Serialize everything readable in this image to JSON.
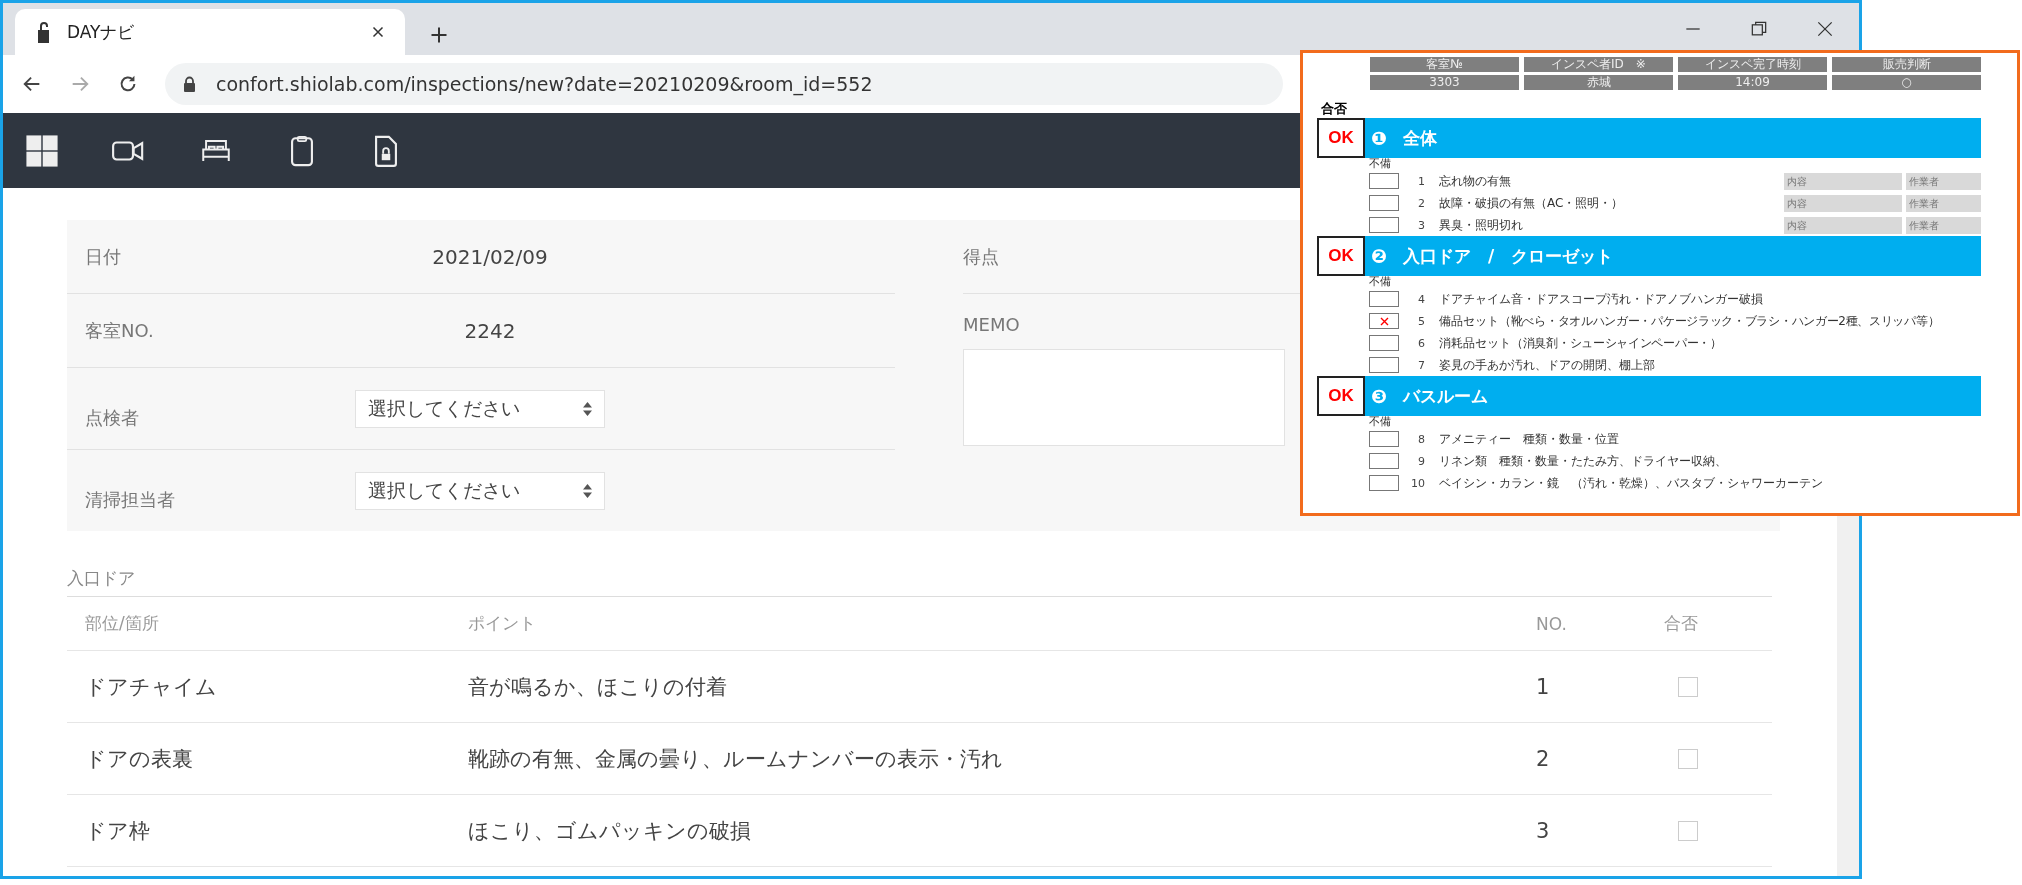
{
  "browser": {
    "tab_title": "DAYナビ",
    "url": "confort.shiolab.com/inspections/new?date=20210209&room_id=552"
  },
  "info": {
    "fields": [
      {
        "label": "日付",
        "kind": "text",
        "value": "2021/02/09"
      },
      {
        "label": "客室NO.",
        "kind": "text",
        "value": "2242"
      },
      {
        "label": "点検者",
        "kind": "select",
        "value": "選択してください"
      },
      {
        "label": "清掃担当者",
        "kind": "select",
        "value": "選択してください"
      }
    ],
    "score_label": "得点",
    "memo_label": "MEMO"
  },
  "checklist": {
    "title": "入口ドア",
    "columns": [
      "部位/箇所",
      "ポイント",
      "NO.",
      "合否"
    ],
    "rows": [
      {
        "part": "ドアチャイム",
        "point": "音が鳴るか、ほこりの付着",
        "no": "1",
        "checked": false
      },
      {
        "part": "ドアの表裏",
        "point": "靴跡の有無、金属の曇り、ルームナンバーの表示・汚れ",
        "no": "2",
        "checked": false
      },
      {
        "part": "ドア枠",
        "point": "ほこり、ゴムパッキンの破損",
        "no": "3",
        "checked": false
      }
    ]
  },
  "scan": {
    "header_labels": [
      "客室№",
      "インスペ者ID　※",
      "インスペ完了時刻",
      "販売判断"
    ],
    "header_values": [
      "3303",
      "赤城",
      "14:09",
      "○"
    ],
    "pass_label": "合否",
    "sections": [
      {
        "badge": "OK",
        "number": "❶",
        "title": "全体",
        "defect_label": "不備",
        "items": [
          {
            "no": "1",
            "text": "忘れ物の有無",
            "checked": false,
            "note": "内容",
            "worker": "作業者"
          },
          {
            "no": "2",
            "text": "故障・破損の有無（AC・照明・）",
            "checked": false,
            "note": "内容",
            "worker": "作業者"
          },
          {
            "no": "3",
            "text": "異臭・照明切れ",
            "checked": false,
            "note": "内容",
            "worker": "作業者"
          }
        ]
      },
      {
        "badge": "OK",
        "number": "❷",
        "title": "入口ドア　/　クローゼット",
        "defect_label": "不備",
        "items": [
          {
            "no": "4",
            "text": "ドアチャイム音・ドアスコープ汚れ・ドアノブハンガー破損",
            "checked": false
          },
          {
            "no": "5",
            "text": "備品セット",
            "sub": "（靴べら・タオルハンガー・パケージラック・ブラシ・ハンガー2種、スリッパ等）",
            "checked": true
          },
          {
            "no": "6",
            "text": "消耗品セット",
            "sub": "（消臭剤・シューシャインペーパー・）",
            "checked": false
          },
          {
            "no": "7",
            "text": "姿見の手あか汚れ、ドアの開閉、棚上部",
            "checked": false
          }
        ]
      },
      {
        "badge": "OK",
        "number": "❸",
        "title": "バスルーム",
        "defect_label": "不備",
        "items": [
          {
            "no": "8",
            "text": "アメニティー　種類・数量・位置",
            "checked": false
          },
          {
            "no": "9",
            "text": "リネン類　種類・数量・たたみ方、ドライヤー収納、",
            "checked": false
          },
          {
            "no": "10",
            "text": "ベイシン・カラン・鏡　（汚れ・乾燥）、バスタブ・シャワーカーテン",
            "checked": false
          }
        ]
      }
    ]
  }
}
